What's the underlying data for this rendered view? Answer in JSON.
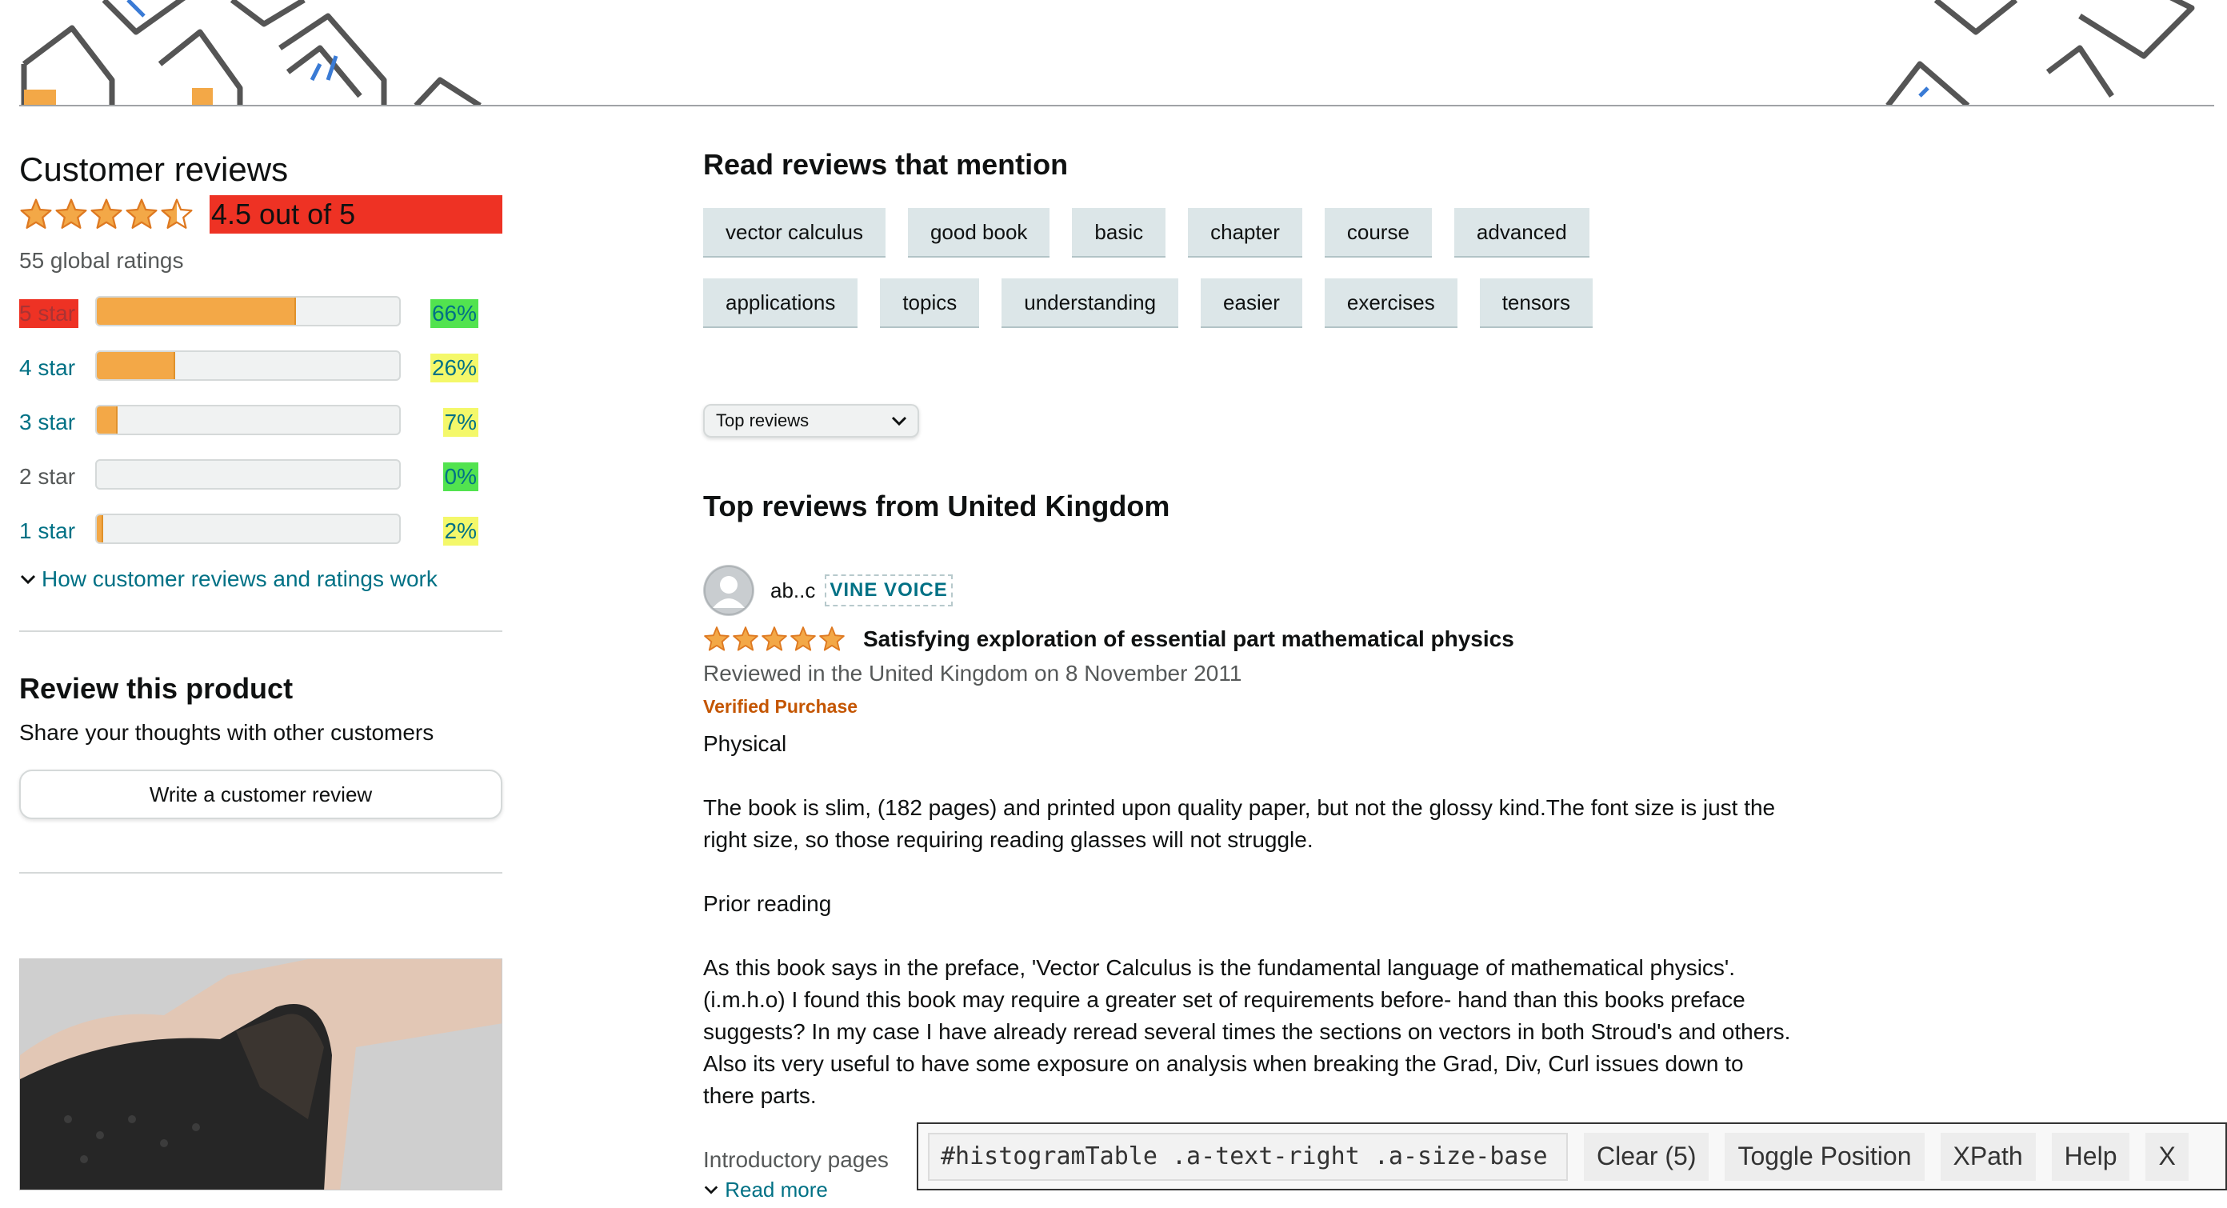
{
  "summary": {
    "heading": "Customer reviews",
    "rating_text": "4.5 out of 5",
    "rating_value": 4.5,
    "global_ratings": "55 global ratings"
  },
  "histogram": [
    {
      "label": "5 star",
      "pct": "66%",
      "fill": 0.66
    },
    {
      "label": "4 star",
      "pct": "26%",
      "fill": 0.26
    },
    {
      "label": "3 star",
      "pct": "7%",
      "fill": 0.07
    },
    {
      "label": "2 star",
      "pct": "0%",
      "fill": 0.0
    },
    {
      "label": "1 star",
      "pct": "2%",
      "fill": 0.02
    }
  ],
  "how_link": "How customer reviews and ratings work",
  "review_product": {
    "heading": "Review this product",
    "subtext": "Share your thoughts with other customers",
    "button": "Write a customer review"
  },
  "mentions": {
    "heading": "Read reviews that mention",
    "chips": [
      "vector calculus",
      "good book",
      "basic",
      "chapter",
      "course",
      "advanced",
      "applications",
      "topics",
      "understanding",
      "easier",
      "exercises",
      "tensors"
    ]
  },
  "sort": {
    "selected": "Top reviews"
  },
  "top_reviews_heading": "Top reviews from United Kingdom",
  "review": {
    "author": "ab..c",
    "badge": "VINE VOICE",
    "stars": 5,
    "title": "Satisfying exploration of essential part mathematical physics",
    "date": "Reviewed in the United Kingdom on 8 November 2011",
    "verified": "Verified Purchase",
    "p1": "Physical",
    "p2": "The book is slim, (182 pages) and printed upon quality paper, but not the glossy kind.The font size is just the right size, so those requiring reading glasses will not struggle.",
    "p3": "Prior reading",
    "p4": "As this book says in the preface, 'Vector Calculus is the fundamental language of mathematical physics'. (i.m.h.o) I found this book may require a greater set of requirements before- hand than this books preface suggests? In my case I have already reread several times the sections on vectors in both Stroud's and others. Also its very useful to have some exposure on analysis when breaking the Grad, Div, Curl issues down to there parts.",
    "p5": "Introductory pages",
    "read_more": "Read more"
  },
  "toolbar": {
    "selector": "#histogramTable .a-text-right .a-size-base",
    "clear": "Clear (5)",
    "toggle": "Toggle Position",
    "xpath": "XPath",
    "help": "Help",
    "close": "X"
  },
  "colors": {
    "link": "#007185",
    "star": "#f3a847",
    "highlight_red": "#ee3224",
    "highlight_green": "#52e34f",
    "highlight_yellow": "#f4f86a",
    "verified": "#c45500"
  }
}
